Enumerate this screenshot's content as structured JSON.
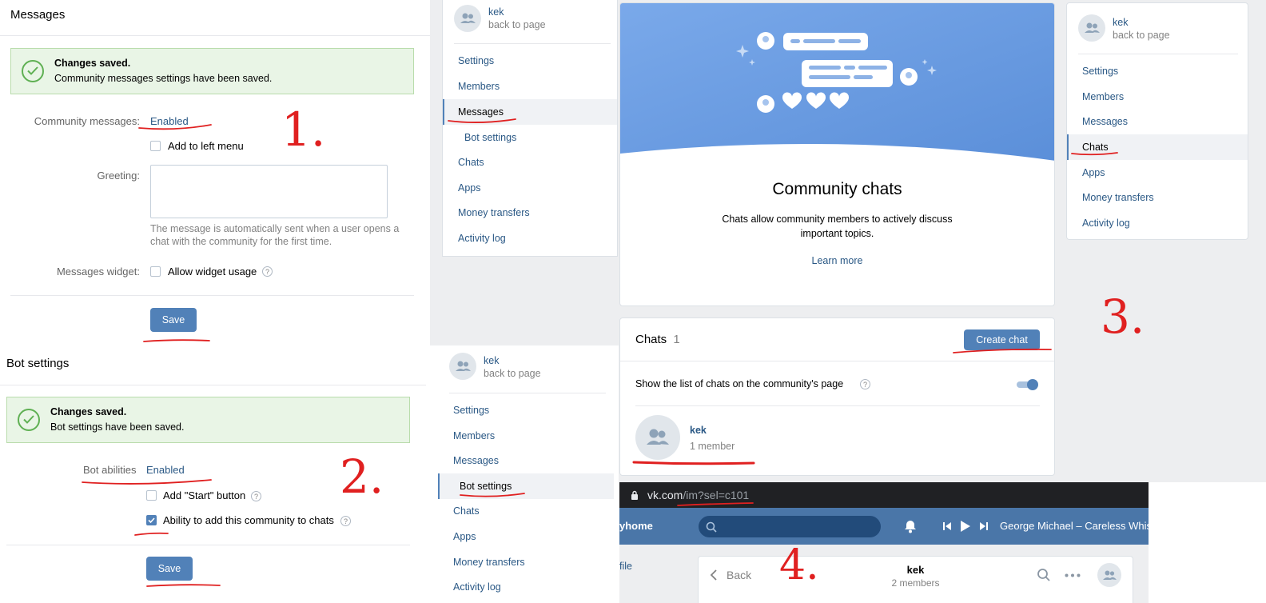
{
  "colors": {
    "accent": "#5181b8",
    "link": "#2a5885",
    "success_bg": "#e9f5e6",
    "annotation_red": "#e02020",
    "vk_header": "#4a76a8"
  },
  "panel1": {
    "title": "Messages",
    "success_title": "Changes saved.",
    "success_text": "Community messages settings have been saved.",
    "community_messages_label": "Community messages:",
    "community_messages_value": "Enabled",
    "add_left_menu": "Add to left menu",
    "greeting_label": "Greeting:",
    "greeting_hint_1": "The message is automatically sent when a user opens a",
    "greeting_hint_2": "chat with the community for the first time.",
    "widget_label": "Messages widget:",
    "allow_widget": "Allow widget usage",
    "save": "Save",
    "annotation": "1."
  },
  "panel2": {
    "title": "Bot settings",
    "success_title": "Changes saved.",
    "success_text": "Bot settings have been saved.",
    "bot_abilities_label": "Bot abilities",
    "bot_abilities_value": "Enabled",
    "add_start": "Add \"Start\" button",
    "ability_add": "Ability to add this community to chats",
    "save": "Save",
    "annotation": "2."
  },
  "sidebar_a": {
    "name": "kek",
    "back": "back to page",
    "items": [
      {
        "label": "Settings"
      },
      {
        "label": "Members"
      },
      {
        "label": "Messages"
      },
      {
        "label": "Bot settings"
      },
      {
        "label": "Chats"
      },
      {
        "label": "Apps"
      },
      {
        "label": "Money transfers"
      },
      {
        "label": "Activity log"
      }
    ]
  },
  "sidebar_b": {
    "name": "kek",
    "back": "back to page",
    "items": [
      {
        "label": "Settings"
      },
      {
        "label": "Members"
      },
      {
        "label": "Messages"
      },
      {
        "label": "Bot settings"
      },
      {
        "label": "Chats"
      },
      {
        "label": "Apps"
      },
      {
        "label": "Money transfers"
      },
      {
        "label": "Activity log"
      }
    ]
  },
  "sidebar_c": {
    "name": "kek",
    "back": "back to page",
    "items": [
      {
        "label": "Settings"
      },
      {
        "label": "Members"
      },
      {
        "label": "Messages"
      },
      {
        "label": "Chats"
      },
      {
        "label": "Apps"
      },
      {
        "label": "Money transfers"
      },
      {
        "label": "Activity log"
      }
    ]
  },
  "chats_promo": {
    "title": "Community chats",
    "desc_1": "Chats allow community members to actively discuss",
    "desc_2": "important topics.",
    "learn_more": "Learn more"
  },
  "chats_list": {
    "title": "Chats",
    "count": "1",
    "create": "Create chat",
    "show_list": "Show the list of chats on the community's page",
    "chat_name": "kek",
    "chat_members": "1 member",
    "annotation": "3."
  },
  "browser": {
    "url_host": "vk.com",
    "url_path": "/im?sel=c101",
    "brand": "yhome",
    "track": "George Michael – Careless Whisp",
    "side_link": "file",
    "back": "Back",
    "chat_title": "kek",
    "chat_members": "2 members",
    "annotation": "4."
  }
}
